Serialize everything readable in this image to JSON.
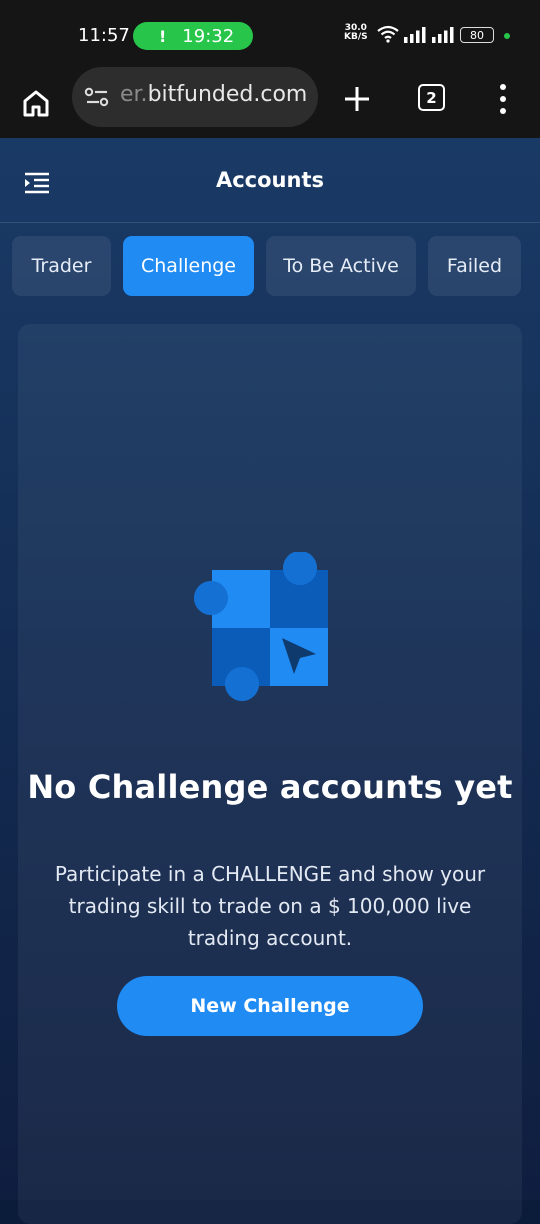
{
  "status_bar": {
    "time": "11:57",
    "call_pill_icon": "!",
    "call_timer": "19:32",
    "net_speed_value": "30.0",
    "net_speed_unit": "KB/S",
    "battery": "80",
    "icons": [
      "wifi-icon",
      "signal-icon",
      "signal-icon",
      "battery-icon"
    ]
  },
  "browser": {
    "url_prefix": "er.",
    "url_domain": "bitfunded.com",
    "tab_count": "2",
    "icons": [
      "home-icon",
      "site-settings-icon",
      "plus-icon",
      "tabs-icon",
      "more-vert-icon"
    ]
  },
  "header": {
    "title": "Accounts",
    "menu_icon": "menu-collapse-icon"
  },
  "tabs": [
    {
      "label": "Trader",
      "active": false
    },
    {
      "label": "Challenge",
      "active": true
    },
    {
      "label": "To Be Active",
      "active": false
    },
    {
      "label": "Failed",
      "active": false
    }
  ],
  "empty_state": {
    "illustration": "puzzle-cursor-icon",
    "title": "No Challenge accounts yet",
    "description": "Participate in a CHALLENGE and show your trading skill to trade on a $ 100,000 live trading account.",
    "cta_label": "New Challenge"
  },
  "colors": {
    "accent": "#1f8bf3",
    "status_pill": "#27c64b",
    "background_top": "#1a3a66",
    "background_bottom": "#0f1e3f"
  }
}
